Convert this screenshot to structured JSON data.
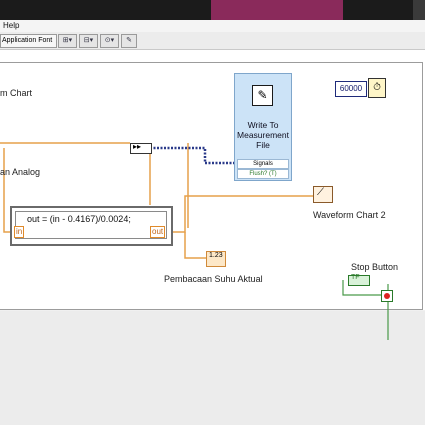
{
  "menu": {
    "help": "Help"
  },
  "toolbar": {
    "font_label": "Application Font"
  },
  "diagram": {
    "waveform_chart_left": "m Chart",
    "analog_reading": "an Analog",
    "formula_expression": "out = (in - 0.4167)/0.0024;",
    "formula_in": "in",
    "formula_out": "out",
    "write_measurement_file": "Write To Measurement File",
    "wtm_signals": "Signals",
    "wtm_flush": "Flush? (T)",
    "waveform_chart_2": "Waveform Chart 2",
    "pembacaan_suhu": "Pembacaan Suhu Aktual",
    "stop_button": "Stop Button",
    "constant_value": "60000"
  },
  "colors": {
    "titlebar": "#1b1b1b",
    "accent": "#8a2a5b",
    "wire_orange": "#e6a04a",
    "wire_blue": "#2a3a8a",
    "wire_green": "#4a9a4a"
  },
  "icons": {
    "wtm_icon": "pen-icon",
    "timer_icon": "timer-icon",
    "chart_icon": "waveform-icon",
    "dbl_icon": "dbl-indicator-icon"
  }
}
